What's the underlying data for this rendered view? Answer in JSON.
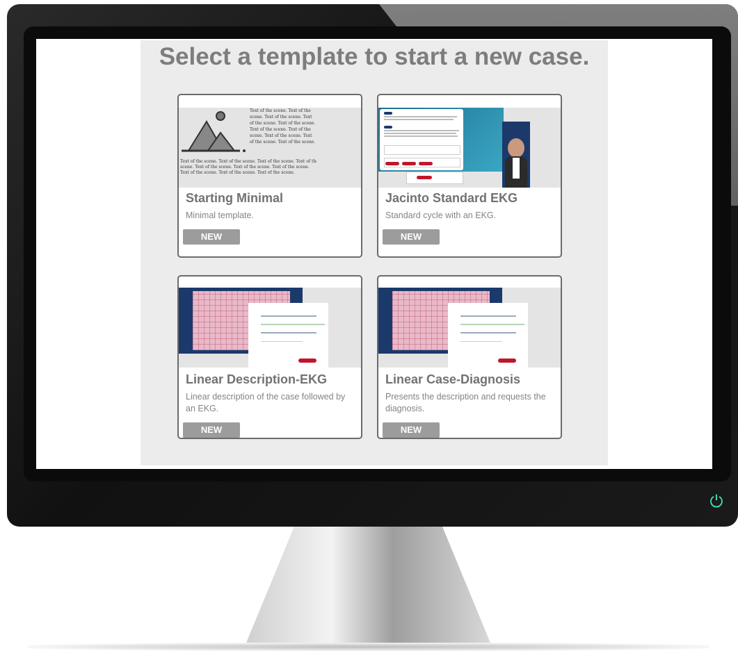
{
  "page_title": "Select a template to start a new case.",
  "thumb_text": {
    "minimal_side": "Text of the scene. Text of the scene. Text of the scene. Text of the scene. Text of the scene. Text of the scene. Text of the scene. Text of the scene. Text of the scene. Text of the scene.",
    "minimal_bottom": "Text of the scene. Text of the scene. Text of the scene. Text of the scene. Text of the scene. Text of the scene. Text of the scene. Text of the scene. Text of the scene. Text of the scene."
  },
  "templates": [
    {
      "name": "Starting Minimal",
      "description": "Minimal template.",
      "button": "NEW"
    },
    {
      "name": "Jacinto Standard EKG",
      "description": "Standard cycle with an EKG.",
      "button": "NEW"
    },
    {
      "name": "Linear Description-EKG",
      "description": "Linear description of the case followed by an EKG.",
      "button": "NEW"
    },
    {
      "name": "Linear Case-Diagnosis",
      "description": "Presents the description and requests the diagnosis.",
      "button": "NEW"
    }
  ],
  "colors": {
    "accent_power": "#3fe0b3",
    "thumb_navy": "#1b3a6b",
    "thumb_red": "#c0162c",
    "ekg_pink": "#e9b9c8"
  }
}
